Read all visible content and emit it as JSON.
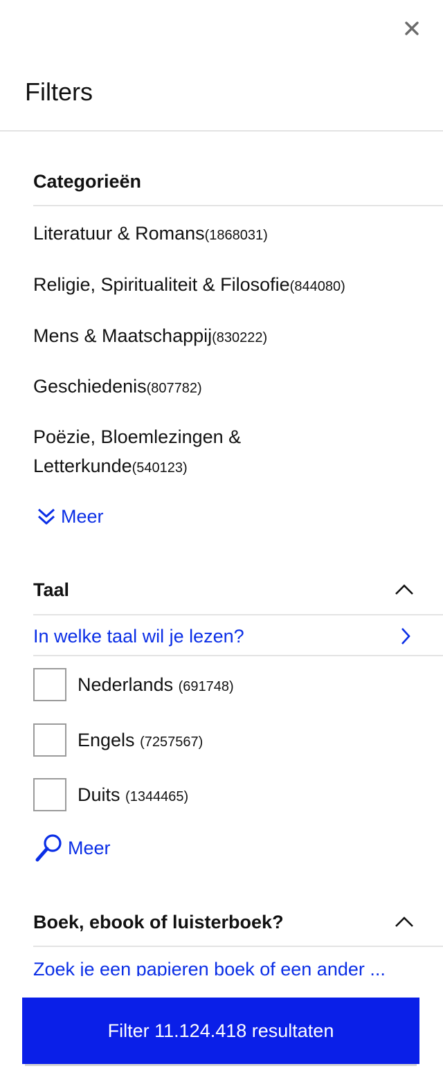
{
  "header": {
    "title": "Filters",
    "close_icon": "close-icon"
  },
  "categories": {
    "title": "Categorieën",
    "items": [
      {
        "label": "Literatuur & Romans",
        "count": "(1868031)"
      },
      {
        "label": "Religie, Spiritualiteit & Filosofie",
        "count": "(844080)"
      },
      {
        "label": "Mens & Maatschappij",
        "count": "(830222)"
      },
      {
        "label": "Geschiedenis",
        "count": "(807782)"
      },
      {
        "label": "Poëzie, Bloemlezingen & Letterkunde",
        "count": "(540123)"
      }
    ],
    "more_label": "Meer",
    "more_icon": "double-chevron-down-icon"
  },
  "language": {
    "title": "Taal",
    "prompt": "In welke taal wil je lezen?",
    "options": [
      {
        "label": "Nederlands",
        "count": "(691748)"
      },
      {
        "label": "Engels",
        "count": "(7257567)"
      },
      {
        "label": "Duits",
        "count": "(1344465)"
      }
    ],
    "more_label": "Meer",
    "more_icon": "search-icon"
  },
  "format": {
    "title": "Boek, ebook of luisterboek?",
    "prompt": "Zoek je een papieren boek of een ander ..."
  },
  "footer": {
    "filter_button_label": "Filter 11.124.418 resultaten"
  },
  "colors": {
    "accent": "#0a1fe8",
    "link": "#0a2ee6",
    "divider": "#e3e3e3"
  }
}
